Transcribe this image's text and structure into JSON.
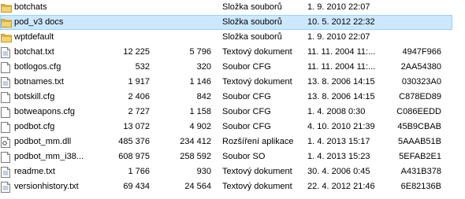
{
  "files": [
    {
      "name": "botchats",
      "size1": "",
      "size2": "",
      "type": "Složka souborů",
      "date": "1. 9. 2010 22:07",
      "crc": "",
      "icon": "folder-icon"
    },
    {
      "name": "pod_v3 docs",
      "size1": "",
      "size2": "",
      "type": "Složka souborů",
      "date": "10. 5. 2012 22:32",
      "crc": "",
      "icon": "folder-icon",
      "selected": true
    },
    {
      "name": "wptdefault",
      "size1": "",
      "size2": "",
      "type": "Složka souborů",
      "date": "1. 9. 2010 22:07",
      "crc": "",
      "icon": "folder-icon"
    },
    {
      "name": "botchat.txt",
      "size1": "12 225",
      "size2": "5 796",
      "type": "Textový dokument",
      "date": "11. 11. 2004 11:...",
      "crc": "4947F966",
      "icon": "text-file-icon"
    },
    {
      "name": "botlogos.cfg",
      "size1": "532",
      "size2": "320",
      "type": "Soubor CFG",
      "date": "11. 11. 2004 11:...",
      "crc": "2AA54380",
      "icon": "file-icon"
    },
    {
      "name": "botnames.txt",
      "size1": "1 917",
      "size2": "1 146",
      "type": "Textový dokument",
      "date": "13. 8. 2006 14:15",
      "crc": "030323A0",
      "icon": "text-file-icon"
    },
    {
      "name": "botskill.cfg",
      "size1": "2 406",
      "size2": "842",
      "type": "Soubor CFG",
      "date": "13. 8. 2006 14:15",
      "crc": "C878ED89",
      "icon": "file-icon"
    },
    {
      "name": "botweapons.cfg",
      "size1": "2 727",
      "size2": "1 158",
      "type": "Soubor CFG",
      "date": "1. 4. 2008 0:30",
      "crc": "C086EEDD",
      "icon": "file-icon"
    },
    {
      "name": "podbot.cfg",
      "size1": "13 072",
      "size2": "4 902",
      "type": "Soubor CFG",
      "date": "4. 10. 2010 21:39",
      "crc": "45B9CBAB",
      "icon": "file-icon"
    },
    {
      "name": "podbot_mm.dll",
      "size1": "485 376",
      "size2": "234 412",
      "type": "Rozšíření aplikace",
      "date": "1. 4. 2013 15:17",
      "crc": "5AAAB51B",
      "icon": "dll-icon"
    },
    {
      "name": "podbot_mm_i38...",
      "size1": "608 975",
      "size2": "258 592",
      "type": "Soubor SO",
      "date": "1. 4. 2013 15:23",
      "crc": "5EFAB2E1",
      "icon": "file-icon"
    },
    {
      "name": "readme.txt",
      "size1": "1 766",
      "size2": "930",
      "type": "Textový dokument",
      "date": "30. 4. 2006 0:45",
      "crc": "A431B378",
      "icon": "text-file-icon"
    },
    {
      "name": "versionhistory.txt",
      "size1": "69 434",
      "size2": "24 564",
      "type": "Textový dokument",
      "date": "22. 4. 2012 21:46",
      "crc": "6E82136B",
      "icon": "text-file-icon"
    }
  ]
}
